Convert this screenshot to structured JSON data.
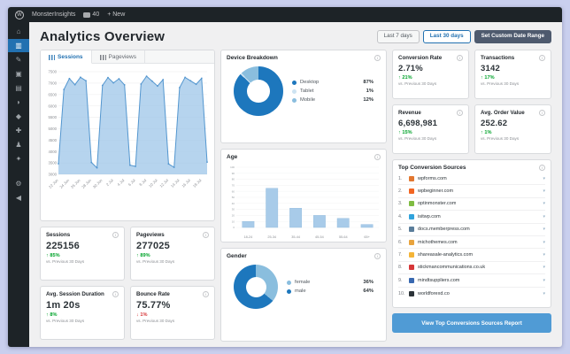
{
  "admin_bar": {
    "wp_logo": "W",
    "site_name": "MonsterInsights",
    "comments_count": "40",
    "new_item": "+ New"
  },
  "sidebar": {
    "items": [
      {
        "name": "dashboard",
        "glyph": "⌂",
        "active": false
      },
      {
        "name": "monsterinsights",
        "glyph": "▥",
        "active": true
      },
      {
        "name": "posts",
        "glyph": "✎",
        "active": false
      },
      {
        "name": "media",
        "glyph": "▣",
        "active": false
      },
      {
        "name": "pages",
        "glyph": "▤",
        "active": false
      },
      {
        "name": "comments",
        "glyph": "◗",
        "active": false
      },
      {
        "name": "appearance",
        "glyph": "◆",
        "active": false
      },
      {
        "name": "plugins",
        "glyph": "✚",
        "active": false
      },
      {
        "name": "users",
        "glyph": "♟",
        "active": false
      },
      {
        "name": "tools",
        "glyph": "✦",
        "active": false
      },
      {
        "name": "settings",
        "glyph": "⚙",
        "active": false
      },
      {
        "name": "collapse-menu",
        "glyph": "◀",
        "active": false
      }
    ]
  },
  "page": {
    "title": "Analytics Overview"
  },
  "date_range": {
    "last_7": "Last 7 days",
    "last_30": "Last 30 days",
    "custom": "Set Custom Date Range"
  },
  "trend_tabs": {
    "sessions": "Sessions",
    "pageviews": "Pageviews"
  },
  "labels": {
    "vs_previous": "vs. Previous 30 Days"
  },
  "colors": {
    "accent_blue": "#2271b1",
    "chart_line": "#5396cf",
    "chart_fill": "#a9cbe8",
    "positive_green": "#00a32a",
    "negative_red": "#d63638",
    "button_blue": "#509bd5",
    "admin_dark": "#1d2327",
    "frame_bg": "#c9cfee"
  },
  "chart_data": [
    {
      "id": "sessions_trend",
      "type": "area",
      "title": "Sessions",
      "x": [
        "22 Jun",
        "23 Jun",
        "24 Jun",
        "25 Jun",
        "26 Jun",
        "27 Jun",
        "28 Jun",
        "29 Jun",
        "30 Jun",
        "1 Jul",
        "2 Jul",
        "3 Jul",
        "4 Jul",
        "5 Jul",
        "6 Jul",
        "7 Jul",
        "8 Jul",
        "9 Jul",
        "10 Jul",
        "11 Jul",
        "12 Jul",
        "13 Jul",
        "14 Jul",
        "15 Jul",
        "16 Jul",
        "17 Jul",
        "18 Jul",
        "19 Jul"
      ],
      "values": [
        3464,
        6721,
        7198,
        6930,
        7256,
        7102,
        3521,
        3289,
        6899,
        7243,
        7011,
        7189,
        6923,
        3402,
        3350,
        6958,
        7302,
        7089,
        6870,
        7150,
        3458,
        3311,
        6801,
        7251,
        7102,
        6950,
        7208,
        3539
      ],
      "ylim": [
        3000,
        7500
      ],
      "yticks": [
        3000,
        3500,
        4000,
        4500,
        5000,
        5500,
        6000,
        6500,
        7000,
        7500
      ],
      "xtick_labels": [
        "22 Jun",
        "24 Jun",
        "26 Jun",
        "28 Jun",
        "30 Jun",
        "2 Jul",
        "4 Jul",
        "6 Jul",
        "8 Jul",
        "10 Jul",
        "12 Jul",
        "14 Jul",
        "16 Jul",
        "18 Jul"
      ],
      "xtick_every": 2,
      "line_color": "#5396cf",
      "fill_color": "rgba(158,197,232,0.75)",
      "grid": true,
      "legend": "none"
    },
    {
      "id": "device_breakdown",
      "type": "pie",
      "title": "Device Breakdown",
      "labels": [
        "Desktop",
        "Tablet",
        "Mobile"
      ],
      "values": [
        87,
        1,
        12
      ],
      "colors": [
        "#1d77bd",
        "#cde3f2",
        "#8abede"
      ],
      "legend": "right"
    },
    {
      "id": "age",
      "type": "bar",
      "title": "Age",
      "categories": [
        "18-24",
        "25-34",
        "35-44",
        "45-54",
        "55-64",
        "65+"
      ],
      "values": [
        10,
        65,
        32,
        20,
        15,
        5
      ],
      "ylim": [
        0,
        100
      ],
      "yticks": [
        0,
        10,
        20,
        30,
        40,
        50,
        60,
        70,
        80,
        90,
        100
      ],
      "bar_color": "#a8cbe9",
      "grid": true
    },
    {
      "id": "gender",
      "type": "pie",
      "title": "Gender",
      "labels": [
        "female",
        "male"
      ],
      "values": [
        36,
        64
      ],
      "colors": [
        "#8abede",
        "#1d77bd"
      ],
      "legend": "right"
    }
  ],
  "site_metrics": [
    {
      "label": "Sessions",
      "value": "225156",
      "delta": "85%",
      "direction": "up"
    },
    {
      "label": "Pageviews",
      "value": "277025",
      "delta": "89%",
      "direction": "up"
    },
    {
      "label": "Avg. Session Duration",
      "value": "1m 20s",
      "delta": "8%",
      "direction": "up"
    },
    {
      "label": "Bounce Rate",
      "value": "75.77%",
      "delta": "1%",
      "direction": "down"
    }
  ],
  "ecommerce_metrics": [
    {
      "label": "Conversion Rate",
      "value": "2.71%",
      "delta": "21%",
      "direction": "up"
    },
    {
      "label": "Transactions",
      "value": "3142",
      "delta": "17%",
      "direction": "up"
    },
    {
      "label": "Revenue",
      "value": "6,698,981",
      "delta": "15%",
      "direction": "up"
    },
    {
      "label": "Avg. Order Value",
      "value": "252.62",
      "delta": "1%",
      "direction": "up"
    }
  ],
  "top_sources": {
    "title": "Top Conversion Sources",
    "items": [
      {
        "rank": "1.",
        "domain": "wpforms.com",
        "favicon_color": "#e27730"
      },
      {
        "rank": "2.",
        "domain": "wpbeginner.com",
        "favicon_color": "#f26522"
      },
      {
        "rank": "3.",
        "domain": "optinmonster.com",
        "favicon_color": "#7fbc42"
      },
      {
        "rank": "4.",
        "domain": "isitwp.com",
        "favicon_color": "#30a3dc"
      },
      {
        "rank": "5.",
        "domain": "docs.memberpress.com",
        "favicon_color": "#5a7d9a"
      },
      {
        "rank": "6.",
        "domain": "michothemes.com",
        "favicon_color": "#e8a33d"
      },
      {
        "rank": "7.",
        "domain": "shareasale-analytics.com",
        "favicon_color": "#f4b437"
      },
      {
        "rank": "8.",
        "domain": "stickmancommunications.co.uk",
        "favicon_color": "#d63638"
      },
      {
        "rank": "9.",
        "domain": "mindtsuppliers.com",
        "favicon_color": "#3868b0"
      },
      {
        "rank": "10.",
        "domain": "worldforexd.co",
        "favicon_color": "#2c3338"
      }
    ],
    "report_button": "View Top Conversions Sources Report"
  }
}
